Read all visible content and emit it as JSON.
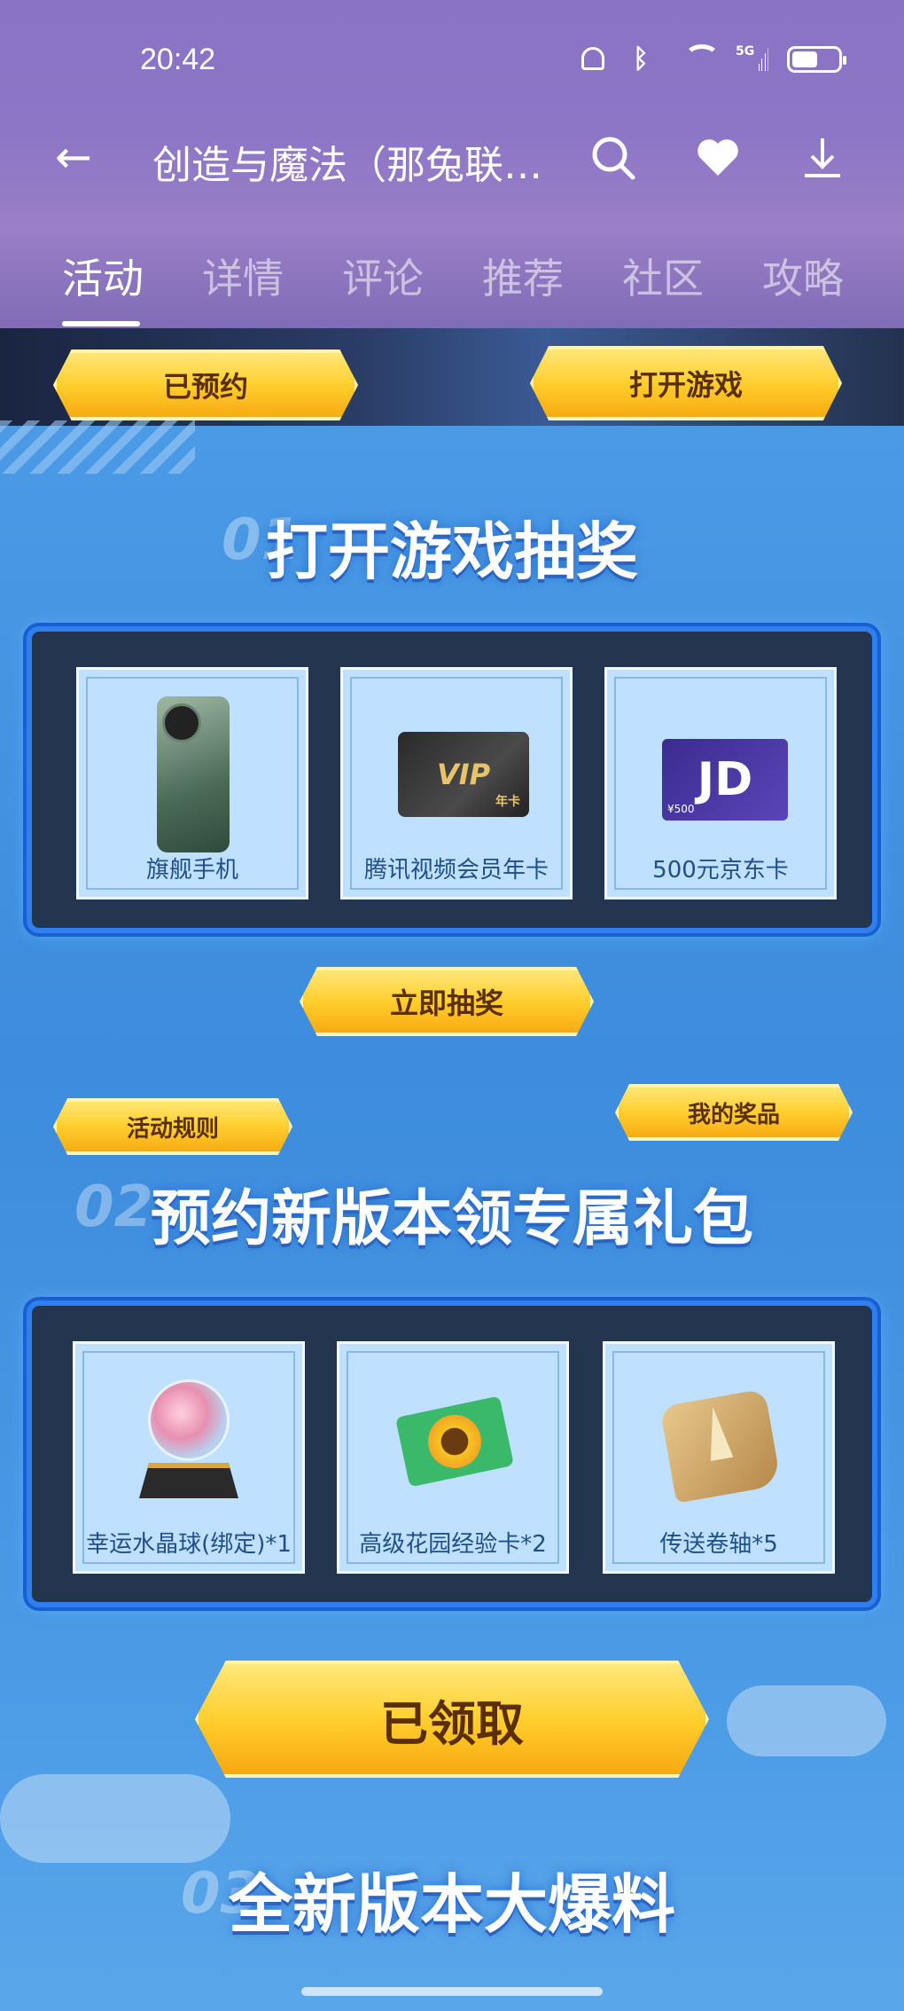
{
  "status_bar": {
    "time": "20:42",
    "network": "5G",
    "battery_percent": 55
  },
  "nav": {
    "title": "创造与魔法（那兔联…"
  },
  "tabs": [
    {
      "label": "活动",
      "active": true
    },
    {
      "label": "详情",
      "active": false
    },
    {
      "label": "评论",
      "active": false
    },
    {
      "label": "推荐",
      "active": false
    },
    {
      "label": "社区",
      "active": false
    },
    {
      "label": "攻略",
      "active": false
    }
  ],
  "banner": {
    "reserved_label": "已预约",
    "open_game_label": "打开游戏"
  },
  "section1": {
    "number": "01",
    "title": "打开游戏抽奖",
    "prizes": [
      {
        "label": "旗舰手机",
        "icon": "phone-icon"
      },
      {
        "label": "腾讯视频会员年卡",
        "icon": "vip-card-icon",
        "art_text": "VIP",
        "art_sub": "年卡"
      },
      {
        "label": "500元京东卡",
        "icon": "jd-card-icon",
        "art_text": "JD",
        "art_sub": "¥500"
      }
    ],
    "draw_button": "立即抽奖",
    "rules_button": "活动规则",
    "my_prizes_button": "我的奖品"
  },
  "section2": {
    "number": "02",
    "title": "预约新版本领专属礼包",
    "gifts": [
      {
        "label": "幸运水晶球(绑定)*1",
        "icon": "crystal-ball-icon"
      },
      {
        "label": "高级花园经验卡*2",
        "icon": "garden-card-icon"
      },
      {
        "label": "传送卷轴*5",
        "icon": "teleport-scroll-icon"
      }
    ],
    "claimed_button": "已领取"
  },
  "section3": {
    "number": "03",
    "title": "全新版本大爆料"
  },
  "colors": {
    "accent_gold": "#ffcf2e",
    "panel_dark": "#24354f",
    "panel_border": "#2f7ff0",
    "header_purple": "#8a73c4"
  }
}
